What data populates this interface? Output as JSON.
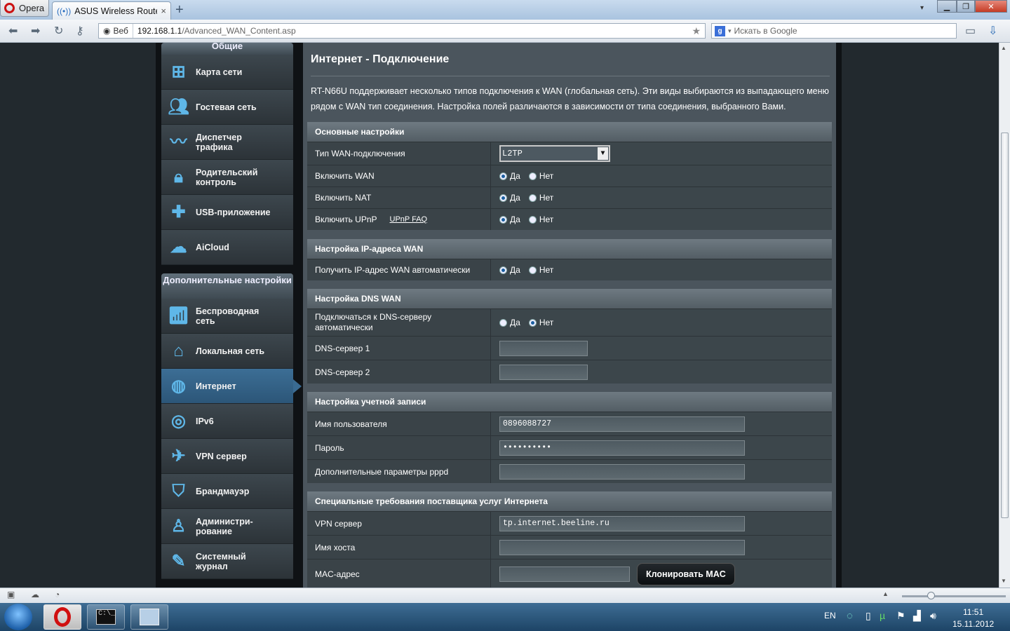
{
  "browser": {
    "opera_label": "Opera",
    "tab_title": "ASUS Wireless Router R...",
    "tab_close": "×",
    "new_tab": "+",
    "site_label": "Веб",
    "url_host": "192.168.1.1",
    "url_path": "/Advanced_WAN_Content.asp",
    "search_placeholder": "Искать в Google"
  },
  "sidebar": {
    "general_header": "Общие",
    "general_items": [
      {
        "label": "Карта сети",
        "icon": "network-map-icon"
      },
      {
        "label": "Гостевая сеть",
        "icon": "guest-network-icon"
      },
      {
        "label": "Диспетчер трафика",
        "icon": "traffic-manager-icon"
      },
      {
        "label": "Родительский контроль",
        "icon": "parental-lock-icon"
      },
      {
        "label": "USB-приложение",
        "icon": "usb-puzzle-icon"
      },
      {
        "label": "AiCloud",
        "icon": "cloud-icon"
      }
    ],
    "advanced_header": "Дополнительные настройки",
    "advanced_items": [
      {
        "label": "Беспроводная сеть",
        "icon": "wireless-icon"
      },
      {
        "label": "Локальная сеть",
        "icon": "home-icon"
      },
      {
        "label": "Интернет",
        "icon": "globe-icon",
        "active": true
      },
      {
        "label": "IPv6",
        "icon": "ipv6-icon"
      },
      {
        "label": "VPN сервер",
        "icon": "vpn-icon"
      },
      {
        "label": "Брандмауэр",
        "icon": "firewall-icon"
      },
      {
        "label": "Администри-рование",
        "icon": "admin-icon"
      },
      {
        "label": "Системный журнал",
        "icon": "log-icon"
      }
    ]
  },
  "page": {
    "title": "Интернет - Подключение",
    "description": "RT-N66U поддерживает несколько типов подключения к WAN (глобальная сеть). Эти виды выбираются из выпадающего меню рядом с WAN тип соединения. Настройка полей различаются в зависимости от типа соединения, выбранного Вами."
  },
  "basic": {
    "header": "Основные настройки",
    "wan_type_label": "Тип WAN-подключения",
    "wan_type_value": "L2TP",
    "enable_wan_label": "Включить WAN",
    "enable_nat_label": "Включить NAT",
    "enable_upnp_label": "Включить UPnP",
    "upnp_faq": "UPnP  FAQ",
    "yes": "Да",
    "no": "Нет"
  },
  "wan_ip": {
    "header": "Настройка IP-адреса WAN",
    "auto_label": "Получить IP-адрес WAN автоматически"
  },
  "dns": {
    "header": "Настройка DNS WAN",
    "auto_label": "Подключаться к DNS-серверу автоматически",
    "dns1_label": "DNS-сервер 1",
    "dns2_label": "DNS-сервер 2",
    "dns1_value": "",
    "dns2_value": ""
  },
  "account": {
    "header": "Настройка учетной записи",
    "user_label": "Имя пользователя",
    "user_value": "0896088727",
    "pass_label": "Пароль",
    "pass_value": "••••••••••",
    "pppd_label": "Дополнительные параметры pppd",
    "pppd_value": ""
  },
  "isp": {
    "header": "Специальные требования поставщика услуг Интернета",
    "vpn_label": "VPN сервер",
    "vpn_value": "tp.internet.beeline.ru",
    "host_label": "Имя хоста",
    "host_value": "",
    "mac_label": "MAC-адрес",
    "mac_value": "",
    "clone_button": "Клонировать MAC"
  },
  "taskbar": {
    "lang": "EN",
    "time": "11:51",
    "date": "15.11.2012"
  },
  "colors": {
    "accent": "#5fb7e8",
    "active_menu": "#3c6e95",
    "panel": "#4b555d"
  }
}
